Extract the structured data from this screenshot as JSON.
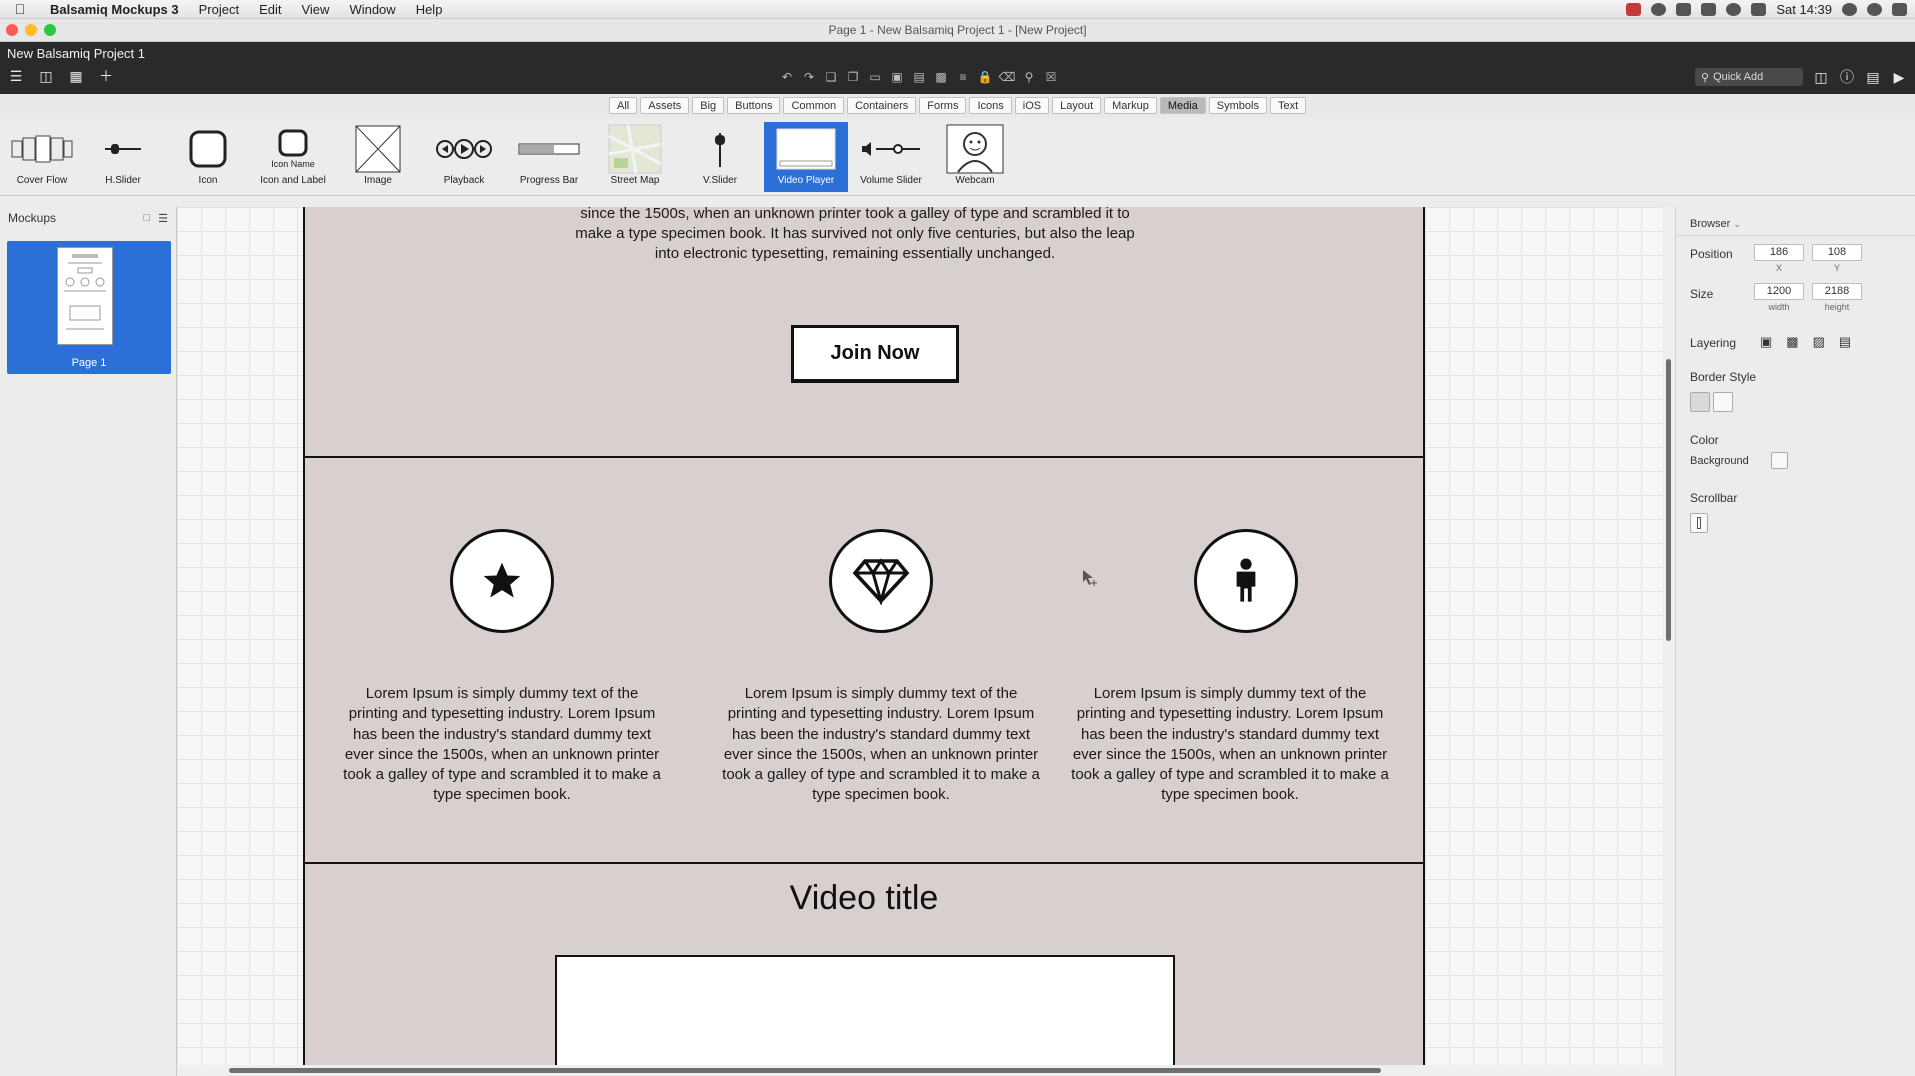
{
  "menubar": {
    "app_name": "Balsamiq Mockups 3",
    "items": [
      "Project",
      "Edit",
      "View",
      "Window",
      "Help"
    ],
    "clock": "Sat 14:39"
  },
  "window": {
    "title": "Page 1 - New Balsamiq Project 1 - [New Project]"
  },
  "toolbar": {
    "project_name": "New Balsamiq Project 1",
    "quick_add_placeholder": "Quick Add"
  },
  "filters": {
    "items": [
      "All",
      "Assets",
      "Big",
      "Buttons",
      "Common",
      "Containers",
      "Forms",
      "Icons",
      "iOS",
      "Layout",
      "Markup",
      "Media",
      "Symbols",
      "Text"
    ],
    "active": "Media"
  },
  "components": [
    {
      "label": "Cover Flow"
    },
    {
      "label": "H.Slider"
    },
    {
      "label": "Icon"
    },
    {
      "label": "Icon and Label",
      "inner_label": "Icon Name"
    },
    {
      "label": "Image"
    },
    {
      "label": "Playback"
    },
    {
      "label": "Progress Bar"
    },
    {
      "label": "Street Map"
    },
    {
      "label": "V.Slider"
    },
    {
      "label": "Video Player",
      "selected": true
    },
    {
      "label": "Volume Slider"
    },
    {
      "label": "Webcam"
    }
  ],
  "mockups_panel": {
    "title": "Mockups",
    "pages": [
      {
        "label": "Page 1"
      }
    ]
  },
  "canvas": {
    "hero_text": "since the 1500s, when an unknown printer took a galley of type and scrambled it to make a type specimen book. It has survived not only five centuries, but also the leap into electronic typesetting, remaining essentially unchanged.",
    "join_button": "Join Now",
    "features": [
      {
        "icon": "star-icon",
        "text": "Lorem Ipsum is simply dummy text of the printing and typesetting industry. Lorem Ipsum has been the industry's standard dummy text ever since the 1500s, when an unknown printer took a galley of type and scrambled it to make a type specimen book."
      },
      {
        "icon": "diamond-icon",
        "text": "Lorem Ipsum is simply dummy text of the printing and typesetting industry. Lorem Ipsum has been the industry's standard dummy text ever since the 1500s, when an unknown printer took a galley of type and scrambled it to make a type specimen book."
      },
      {
        "icon": "person-icon",
        "text": "Lorem Ipsum is simply dummy text of the printing and typesetting industry. Lorem Ipsum has been the industry's standard dummy text ever since the 1500s, when an unknown printer took a galley of type and scrambled it to make a type specimen book."
      }
    ],
    "video_title": "Video title"
  },
  "inspector": {
    "header": "Browser",
    "position_label": "Position",
    "position_x": "186",
    "position_y": "108",
    "x_label": "X",
    "y_label": "Y",
    "size_label": "Size",
    "width": "1200",
    "height": "2188",
    "width_label": "width",
    "height_label": "height",
    "layering_label": "Layering",
    "border_style_label": "Border Style",
    "color_label": "Color",
    "background_label": "Background",
    "scrollbar_label": "Scrollbar"
  },
  "colors": {
    "selection_blue": "#2c6fd6",
    "mockup_bg": "#d8cfcf",
    "dark_toolbar": "#2a2a2c"
  }
}
